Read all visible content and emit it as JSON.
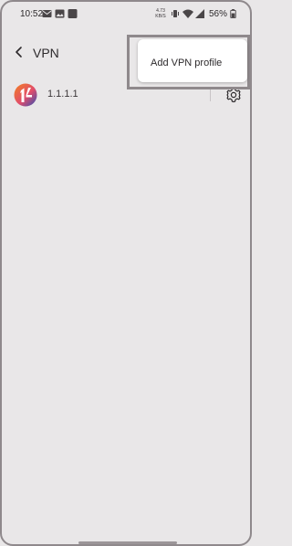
{
  "status_bar": {
    "time": "10:52",
    "network_speed_value": "4.73",
    "network_speed_unit": "KB/S",
    "battery": "56%"
  },
  "header": {
    "title": "VPN",
    "back_icon": "back-arrow-icon"
  },
  "vpn_profiles": [
    {
      "name": "1.1.1.1",
      "icon": "cloudflare-1111-app-icon",
      "settings_icon": "gear-icon"
    }
  ],
  "popup_menu": {
    "items": [
      {
        "label": "Add VPN profile"
      }
    ]
  },
  "colors": {
    "background": "#e9e7e8",
    "popup": "#ffffff",
    "text": "#2d2a2c",
    "logo_orange": "#f38020",
    "logo_blue": "#2d4fb6"
  }
}
